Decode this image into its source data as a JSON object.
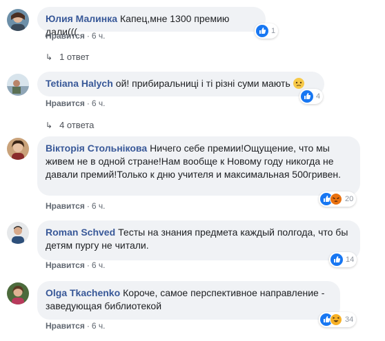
{
  "comments": [
    {
      "author": "Юлия Малинка",
      "text": "Капец,мне 1300 премию дали(((",
      "like_label": "Нравится",
      "time": "6 ч.",
      "reaction_count": "1",
      "reactions": [
        "like"
      ],
      "replies_label": "1 ответ"
    },
    {
      "author": "Tetiana Halych",
      "text": "ой! прибиральниці і ті різні суми мають",
      "emoji": "unamused-face",
      "like_label": "Нравится",
      "time": "6 ч.",
      "reaction_count": "4",
      "reactions": [
        "like"
      ],
      "replies_label": "4 ответа"
    },
    {
      "author": "Вікторія Стольнікова",
      "text": "Ничего себе премии!Ощущение, что мы живем не в одной стране!Нам вообще к Новому году никогда не давали премий!Только к дню учителя и максимальная 500гривен.",
      "like_label": "Нравится",
      "time": "6 ч.",
      "reaction_count": "20",
      "reactions": [
        "like",
        "angry"
      ]
    },
    {
      "author": "Roman Schved",
      "text": "Тесты на знания предмета каждый полгода, что бы детям пургу не читали.",
      "like_label": "Нравится",
      "time": "6 ч.",
      "reaction_count": "14",
      "reactions": [
        "like"
      ]
    },
    {
      "author": "Olga Tkachenko",
      "text": "Короче, самое перспективное направление - заведующая библиотекой",
      "like_label": "Нравится",
      "time": "6 ч.",
      "reaction_count": "34",
      "reactions": [
        "like",
        "haha"
      ]
    }
  ],
  "colors": {
    "author": "#385898",
    "bubble": "#f0f2f5",
    "like_reaction": "#1877f2",
    "angry_reaction": "#e9710f",
    "haha_reaction": "#f7b125"
  },
  "icons": {
    "reply_arrow": "reply-arrow-icon",
    "like": "like-reaction-icon",
    "angry": "angry-reaction-icon",
    "haha": "haha-reaction-icon"
  }
}
